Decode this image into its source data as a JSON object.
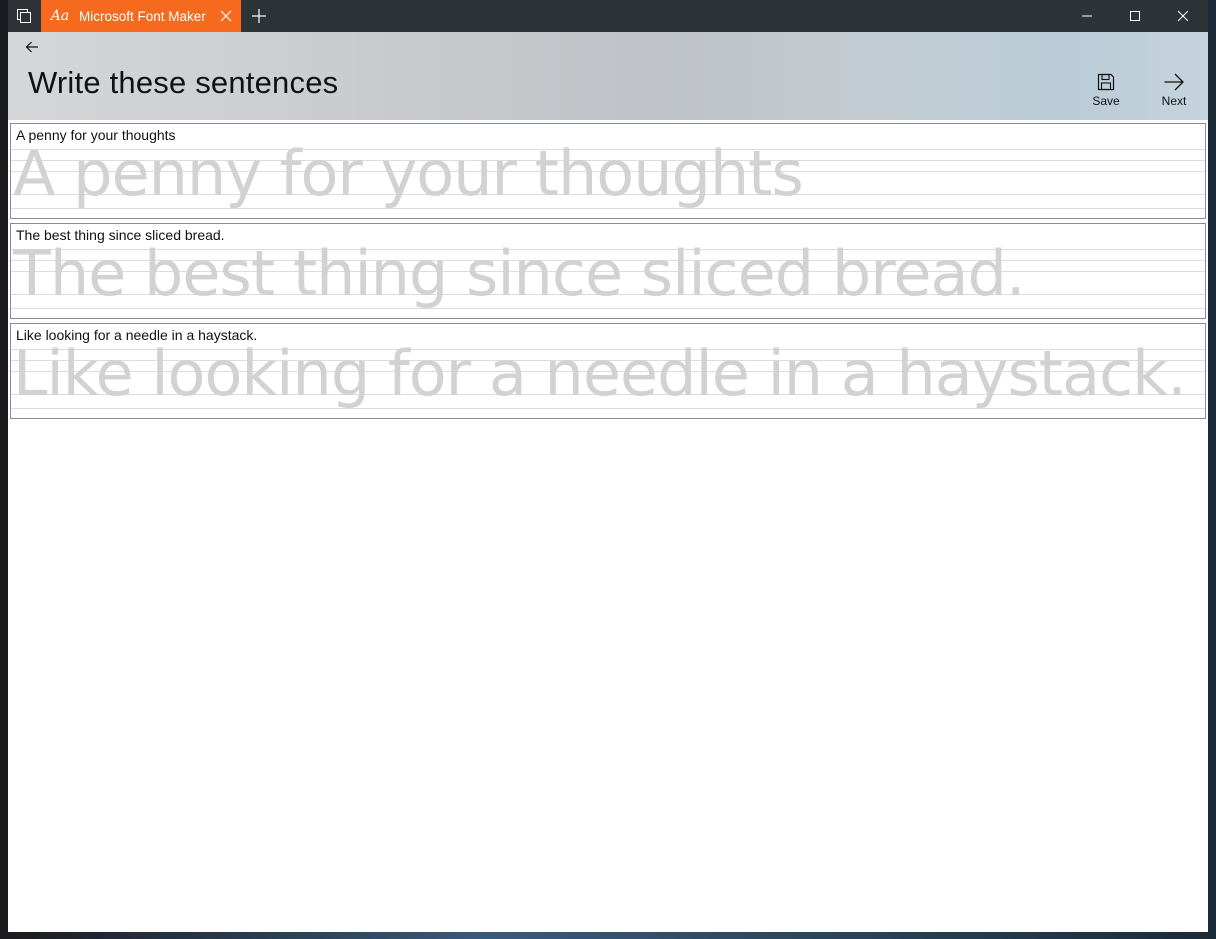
{
  "window": {
    "tab_title": "Microsoft Font Maker",
    "tab_icon": "font-maker-icon"
  },
  "header": {
    "title": "Write these sentences",
    "save_label": "Save",
    "next_label": "Next"
  },
  "sentences": [
    {
      "label": "A penny for your thoughts",
      "guide": "A penny for your thoughts"
    },
    {
      "label": "The best thing since sliced bread.",
      "guide": "The best thing since sliced bread."
    },
    {
      "label": "Like looking for a needle in a haystack.",
      "guide": "Like looking for a needle in a haystack."
    }
  ],
  "colors": {
    "tab_accent": "#f56a1e",
    "titlebar": "#2e3338",
    "guide_text": "#d2d2d2"
  }
}
